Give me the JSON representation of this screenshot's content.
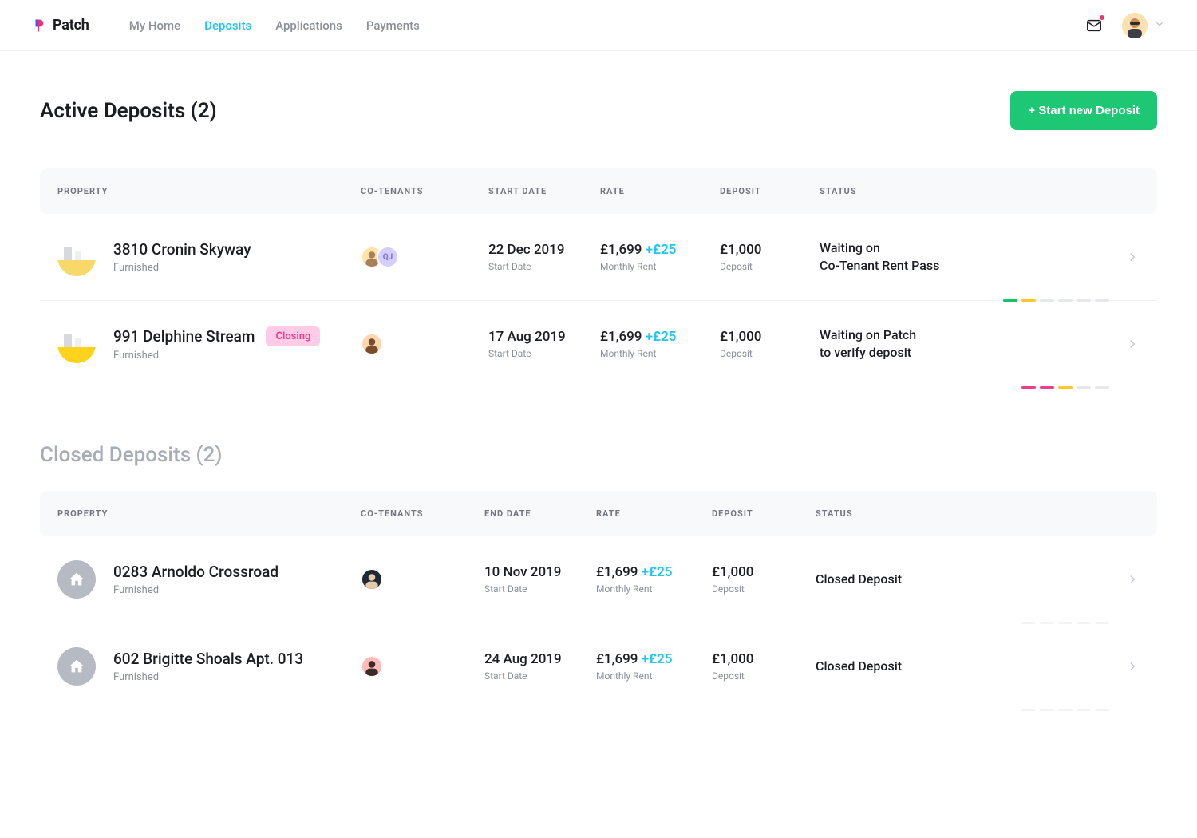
{
  "brand": {
    "name": "Patch"
  },
  "nav": {
    "myhome": "My Home",
    "deposits": "Deposits",
    "applications": "Applications",
    "payments": "Payments"
  },
  "actions": {
    "start_deposit": "+ Start new Deposit"
  },
  "sections": {
    "active_title": "Active Deposits (2)",
    "closed_title": "Closed Deposits (2)"
  },
  "cols": {
    "property": "Property",
    "tenants": "Co-Tenants",
    "start": "Start Date",
    "end": "End Date",
    "rate": "Rate",
    "deposit": "Deposit",
    "status": "Status"
  },
  "labels": {
    "start_date": "Start Date",
    "monthly_rent": "Monthly Rent",
    "deposit": "Deposit"
  },
  "active": [
    {
      "address": "3810 Cronin Skyway",
      "sub": "Furnished",
      "badge": null,
      "date": "22 Dec 2019",
      "rent": "£1,699",
      "rent_inc": "+£25",
      "deposit": "£1,000",
      "status_l1": "Waiting on",
      "status_l2": "Co-Tenant Rent Pass",
      "progress": [
        "green",
        "yellow",
        "",
        "",
        "",
        ""
      ],
      "tenants": [
        {
          "type": "img",
          "bg": "#ffe4a8",
          "face": "#a97f5c"
        },
        {
          "type": "init",
          "text": "QJ",
          "bg": "#d5cfff",
          "fg": "#7d6bf0"
        }
      ],
      "thumb_bg": "#fff",
      "thumb_accent": "#f7d96a"
    },
    {
      "address": "991 Delphine Stream",
      "sub": "Furnished",
      "badge": "Closing",
      "date": "17 Aug 2019",
      "rent": "£1,699",
      "rent_inc": "+£25",
      "deposit": "£1,000",
      "status_l1": "Waiting on Patch",
      "status_l2": "to verify deposit",
      "progress": [
        "pink",
        "pink",
        "yellow",
        "",
        ""
      ],
      "tenants": [
        {
          "type": "img",
          "bg": "#ffd6b0",
          "face": "#7a4c2e"
        }
      ],
      "thumb_bg": "#fff",
      "thumb_accent": "#ffd21e"
    }
  ],
  "closed": [
    {
      "address": "0283 Arnoldo Crossroad",
      "sub": "Furnished",
      "date": "10 Nov 2019",
      "rent": "£1,699",
      "rent_inc": "+£25",
      "deposit": "£1,000",
      "status": "Closed Deposit",
      "tenants": [
        {
          "type": "img",
          "bg": "#202a36",
          "face": "#e7c9a8"
        }
      ]
    },
    {
      "address": "602 Brigitte Shoals Apt. 013",
      "sub": "Furnished",
      "date": "24 Aug 2019",
      "rent": "£1,699",
      "rent_inc": "+£25",
      "deposit": "£1,000",
      "status": "Closed Deposit",
      "tenants": [
        {
          "type": "img",
          "bg": "#ffbcb9",
          "face": "#3b2b28"
        }
      ]
    }
  ]
}
